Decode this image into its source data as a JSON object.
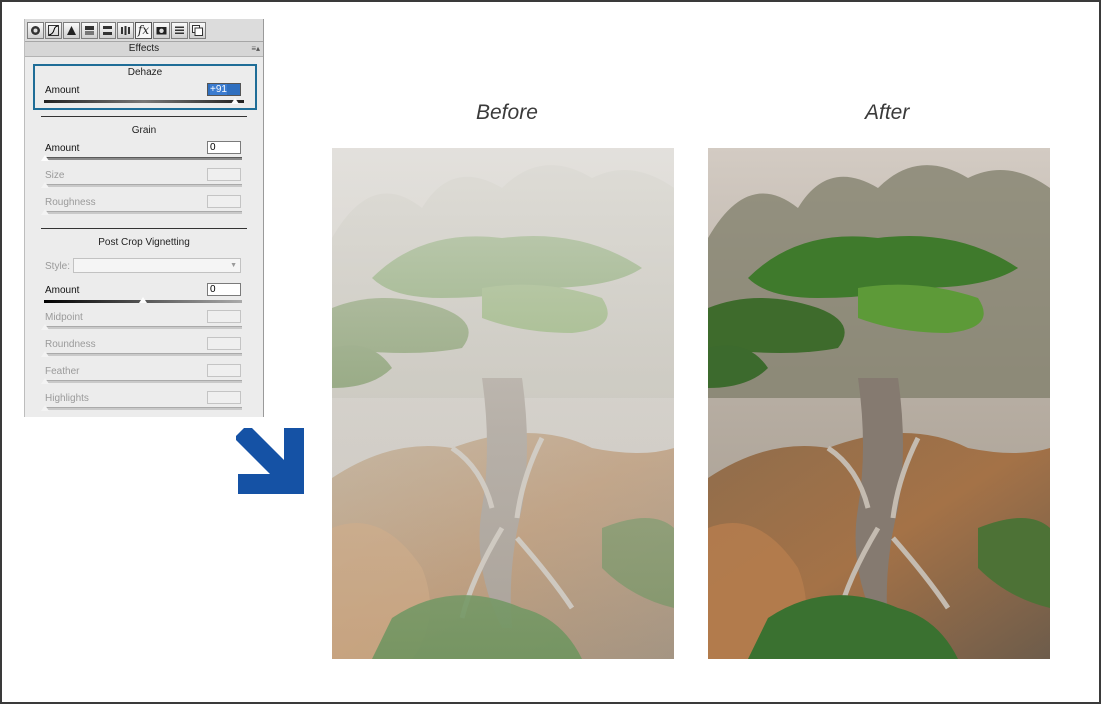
{
  "toolbar": {
    "icons": [
      "basic-icon",
      "tone-curve-icon",
      "detail-icon",
      "hsl-icon",
      "split-toning-icon",
      "lens-corrections-icon",
      "effects-fx-icon",
      "camera-calibration-icon",
      "presets-icon",
      "snapshots-icon"
    ],
    "fx_glyph": "fx"
  },
  "panel": {
    "title": "Effects",
    "menu_glyph": "≡▴"
  },
  "dehaze": {
    "title": "Dehaze",
    "amount_label": "Amount",
    "amount_value": "+91",
    "slider_fraction": 0.955
  },
  "grain": {
    "title": "Grain",
    "amount_label": "Amount",
    "amount_value": "0",
    "size_label": "Size",
    "roughness_label": "Roughness"
  },
  "vignette": {
    "title": "Post Crop Vignetting",
    "style_label": "Style:",
    "amount_label": "Amount",
    "amount_value": "0",
    "midpoint_label": "Midpoint",
    "roundness_label": "Roundness",
    "feather_label": "Feather",
    "highlights_label": "Highlights"
  },
  "comparison": {
    "before_label": "Before",
    "after_label": "After"
  },
  "colors": {
    "highlight_border": "#1f6d97",
    "arrow": "#1552a5"
  }
}
